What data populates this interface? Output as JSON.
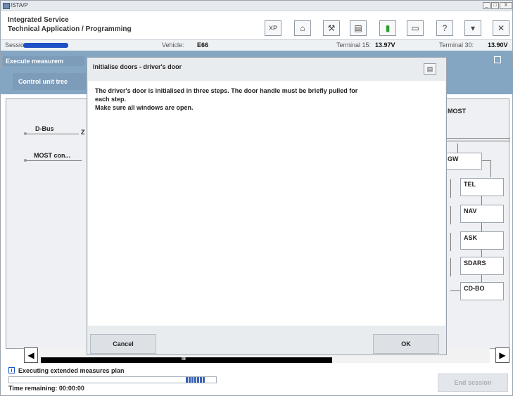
{
  "window": {
    "title": "ISTA/P",
    "controls": [
      "_",
      "□",
      "X"
    ]
  },
  "header": {
    "line1": "Integrated Service",
    "line2": "Technical Application / Programming",
    "toolbar": [
      {
        "name": "xp-button",
        "label": "XP"
      },
      {
        "name": "home-button",
        "label": "⌂"
      },
      {
        "name": "wrench-button",
        "label": "⚒"
      },
      {
        "name": "print-button",
        "label": "▤"
      },
      {
        "name": "battery-button",
        "label": "▮"
      },
      {
        "name": "screen-button",
        "label": "▭"
      },
      {
        "name": "help-button",
        "label": "?"
      },
      {
        "name": "minimize-app-button",
        "label": "▾"
      },
      {
        "name": "close-app-button",
        "label": "✕"
      }
    ]
  },
  "infobar": {
    "session_label": "Session:",
    "vehicle_label": "Vehicle:",
    "vehicle_value": "E66",
    "terminal15_label": "Terminal 15:",
    "terminal15_value": "13.97V",
    "terminal30_label": "Terminal 30:",
    "terminal30_value": "13.90V"
  },
  "tabs": {
    "execute": "Execute measurem",
    "control_unit_tree": "Control unit tree"
  },
  "tree": {
    "buses": [
      "D-Bus",
      "MOST con..."
    ],
    "z_label": "Z",
    "most_label": "MOST",
    "modules": [
      "GW",
      "TEL",
      "NAV",
      "ASK",
      "SDARS",
      "CD-BO"
    ]
  },
  "dialog": {
    "title": "Initialise doors - driver's door",
    "text_line1": "The driver's door is initialised in three steps. The door handle must be briefly pulled for",
    "text_line2": "each step.",
    "text_line3": "Make sure all windows are open.",
    "cancel_label": "Cancel",
    "ok_label": "OK"
  },
  "scroll": {
    "left_arrow": "◀",
    "right_arrow": "▶",
    "thumb_label": "III"
  },
  "status": {
    "info_icon": "i",
    "text": "Executing extended measures plan",
    "progress_fraction": 0.1,
    "time_remaining": "Time remaining: 00:00:00",
    "end_session_label": "End session"
  }
}
